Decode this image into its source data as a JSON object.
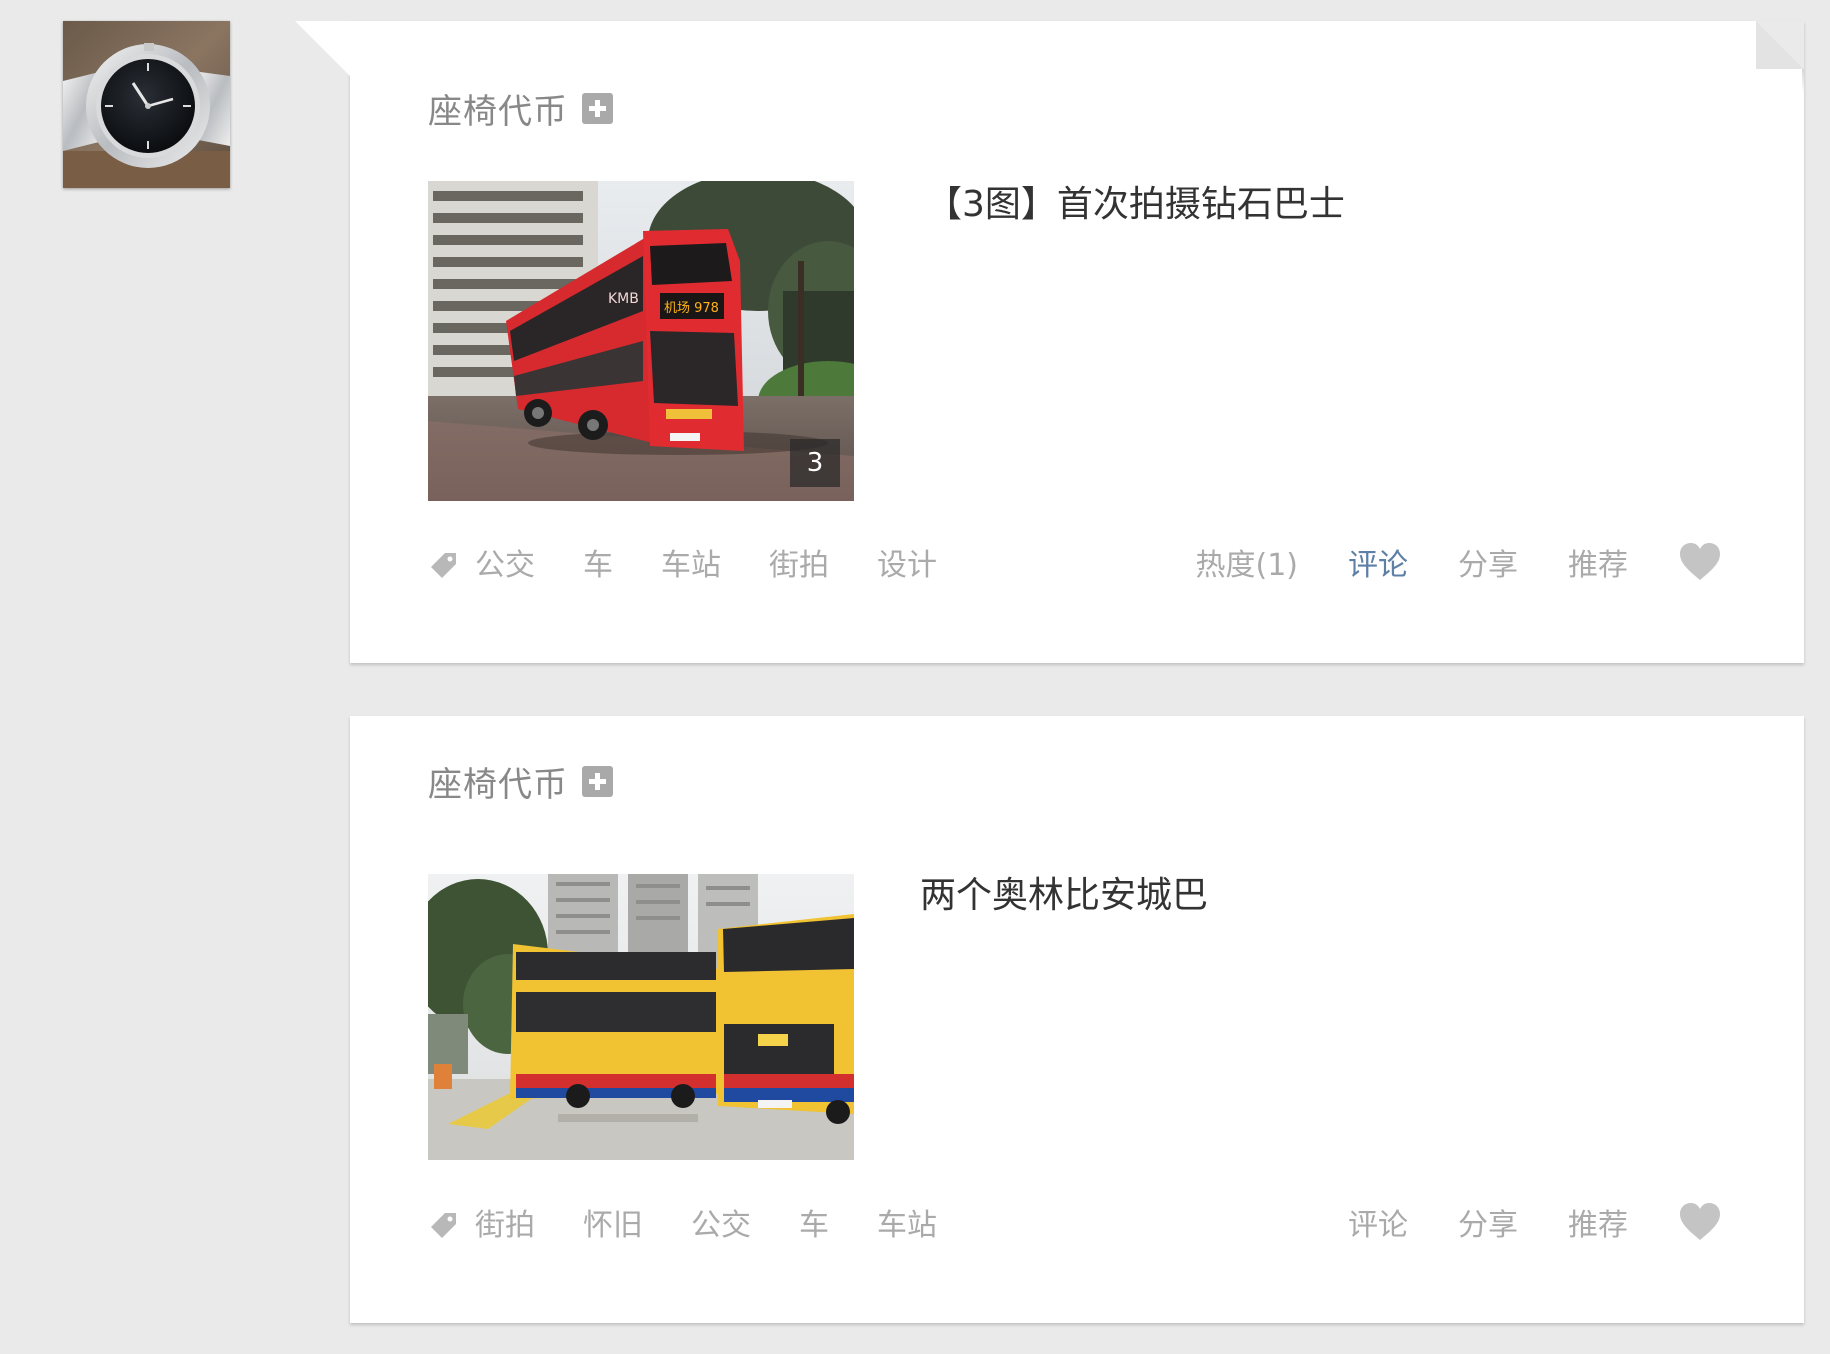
{
  "colors": {
    "page_bg": "#eaeaeb",
    "card_bg": "#ffffff",
    "muted_text": "#aaaaaa",
    "author_text": "#888888",
    "title_text": "#333333",
    "active_link": "#5f80a6",
    "heart": "#c4c4c4"
  },
  "avatar": {
    "icon": "wristwatch-photo"
  },
  "posts": [
    {
      "author": "座椅代币",
      "follow_icon": "plus-square-icon",
      "title": "【3图】首次拍摄钻石巴士",
      "image": {
        "subject": "red-double-decker-bus-photo",
        "count": "3"
      },
      "tags": [
        "公交",
        "车",
        "车站",
        "街拍",
        "设计"
      ],
      "actions": {
        "heat": "热度(1)",
        "comment": "评论",
        "share": "分享",
        "recommend": "推荐"
      },
      "like_icon": "heart-icon"
    },
    {
      "author": "座椅代币",
      "follow_icon": "plus-square-icon",
      "title": "两个奥林比安城巴",
      "image": {
        "subject": "yellow-double-decker-buses-photo"
      },
      "tags": [
        "街拍",
        "怀旧",
        "公交",
        "车",
        "车站"
      ],
      "actions": {
        "comment": "评论",
        "share": "分享",
        "recommend": "推荐"
      },
      "like_icon": "heart-icon"
    }
  ]
}
